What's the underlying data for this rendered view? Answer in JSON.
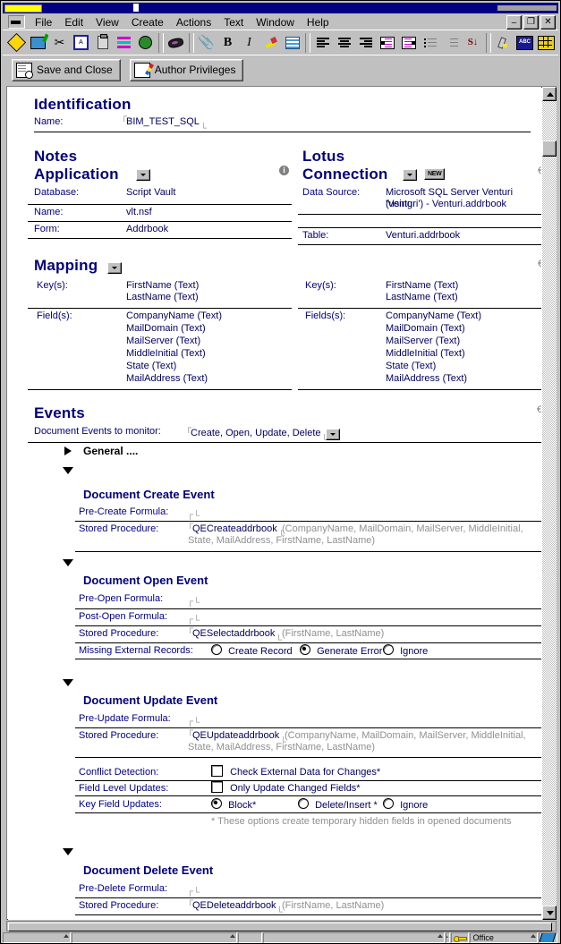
{
  "window": {
    "controls": {
      "minimize": "–",
      "restore": "❐",
      "close": "✕"
    }
  },
  "menu": {
    "items": [
      {
        "label": "File"
      },
      {
        "label": "Edit"
      },
      {
        "label": "View"
      },
      {
        "label": "Create"
      },
      {
        "label": "Actions"
      },
      {
        "label": "Text"
      },
      {
        "label": "Window"
      },
      {
        "label": "Help"
      }
    ]
  },
  "toolbar": {
    "buttons": [
      "navigator-icon",
      "bookmark-icon",
      "cut-icon",
      "copy-icon",
      "paste-icon",
      "properties-icon",
      "globe-link-icon",
      "erase-icon",
      "attach-icon",
      "bold-icon",
      "italic-icon",
      "highlight-icon",
      "permanent-pen-icon",
      "align-left-icon",
      "align-center-icon",
      "align-right-icon",
      "indent-icon",
      "outdent-icon",
      "bullet-list-icon",
      "number-list-icon",
      "sort-icon",
      "text-color-icon",
      "spell-check-icon",
      "table-icon"
    ]
  },
  "actionbar": {
    "save_and_close": "Save and Close",
    "author_privileges": "Author Privileges"
  },
  "identification": {
    "title": "Identification",
    "name_label": "Name:",
    "name_value": "BIM_TEST_SQL"
  },
  "notes_application": {
    "title_line1": "Notes",
    "title_line2": "Application",
    "database_label": "Database:",
    "database_value": "Script Vault",
    "name_label": "Name:",
    "name_value": "vlt.nsf",
    "form_label": "Form:",
    "form_value": "Addrbook"
  },
  "lotus_connection": {
    "title_line1": "Lotus",
    "title_line2": "Connection",
    "new_button": "NEW",
    "data_source_label": "Data Source:",
    "data_source_value_line1": "Microsoft SQL Server Venturi (using",
    "data_source_value_line2": "'Venturi') - Venturi.addrbook",
    "table_label": "Table:",
    "table_value": "Venturi.addrbook"
  },
  "mapping": {
    "title": "Mapping",
    "left": {
      "keys_label": "Key(s):",
      "keys": [
        "FirstName (Text)",
        "LastName (Text)"
      ],
      "fields_label": "Field(s):",
      "fields": [
        "CompanyName (Text)",
        "MailDomain (Text)",
        "MailServer (Text)",
        "MiddleInitial (Text)",
        "State (Text)",
        "MailAddress (Text)"
      ]
    },
    "right": {
      "keys_label": "Key(s):",
      "keys": [
        "FirstName (Text)",
        "LastName (Text)"
      ],
      "fields_label": "Fields(s):",
      "fields": [
        "CompanyName (Text)",
        "MailDomain (Text)",
        "MailServer (Text)",
        "MiddleInitial (Text)",
        "State (Text)",
        "MailAddress (Text)"
      ]
    }
  },
  "events": {
    "title": "Events",
    "monitor_label": "Document Events to monitor:",
    "monitor_value": "Create, Open, Update, Delete",
    "general_label": "General ....",
    "create": {
      "heading": "Document Create Event",
      "pre_formula_label": "Pre-Create Formula:",
      "pre_formula_value": "",
      "stored_proc_label": "Stored Procedure:",
      "stored_proc_value": "QECreateaddrbook",
      "stored_proc_args_line1": "(CompanyName, MailDomain, MailServer, MiddleInitial,",
      "stored_proc_args_line2": "State, MailAddress, FirstName, LastName)"
    },
    "open": {
      "heading": "Document Open Event",
      "pre_formula_label": "Pre-Open Formula:",
      "pre_formula_value": "",
      "post_formula_label": "Post-Open Formula:",
      "post_formula_value": "",
      "stored_proc_label": "Stored Procedure:",
      "stored_proc_value": "QESelectaddrbook",
      "stored_proc_args": "(FirstName, LastName)",
      "missing_label": "Missing External Records:",
      "options": [
        {
          "label": "Create Record",
          "selected": false
        },
        {
          "label": "Generate Error",
          "selected": true
        },
        {
          "label": "Ignore",
          "selected": false
        }
      ]
    },
    "update": {
      "heading": "Document Update Event",
      "pre_formula_label": "Pre-Update Formula:",
      "pre_formula_value": "",
      "stored_proc_label": "Stored Procedure:",
      "stored_proc_value": "QEUpdateaddrbook",
      "stored_proc_args_line1": "(CompanyName, MailDomain, MailServer, MiddleInitial,",
      "stored_proc_args_line2": "State, MailAddress, FirstName, LastName)",
      "conflict_label": "Conflict Detection:",
      "conflict_checkbox": "Check External Data for Changes*",
      "conflict_checked": false,
      "field_level_label": "Field Level Updates:",
      "field_level_checkbox": "Only Update Changed Fields*",
      "field_level_checked": false,
      "key_field_label": "Key Field Updates:",
      "key_field_options": [
        {
          "label": "Block*",
          "selected": true
        },
        {
          "label": "Delete/Insert *",
          "selected": false
        },
        {
          "label": "Ignore",
          "selected": false
        }
      ],
      "footnote": "* These options create temporary hidden fields in opened documents"
    },
    "delete": {
      "heading": "Document Delete Event",
      "pre_formula_label": "Pre-Delete Formula:",
      "pre_formula_value": "",
      "stored_proc_label": "Stored Procedure:",
      "stored_proc_value": "QEDeleteaddrbook",
      "stored_proc_args": "(FirstName, LastName)"
    }
  },
  "statusbar": {
    "location": "Office"
  },
  "colors": {
    "heading": "#00007a",
    "label": "#000080",
    "value": "#000060",
    "gray": "#909090",
    "titlebar": "#000080",
    "chrome": "#c0c0c0"
  }
}
